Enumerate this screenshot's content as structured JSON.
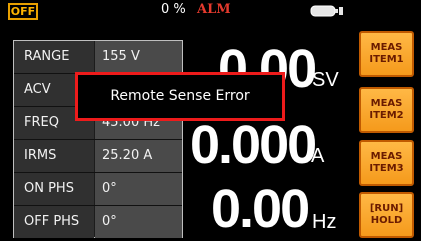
{
  "status": {
    "output_state": "OFF",
    "percent": "0 %",
    "alarm": "ALM",
    "icon": "battery-plug-icon"
  },
  "params": [
    {
      "label": "RANGE",
      "value": "155 V"
    },
    {
      "label": "ACV",
      "value": ""
    },
    {
      "label": "FREQ",
      "value": "45.00 Hz"
    },
    {
      "label": "IRMS",
      "value": "25.20 A"
    },
    {
      "label": "ON PHS",
      "value": "0°"
    },
    {
      "label": "OFF PHS",
      "value": "0°"
    }
  ],
  "readings": {
    "voltage": {
      "value": "0.00",
      "unit": "SV"
    },
    "current": {
      "value": "0.000",
      "unit": "A"
    },
    "frequency": {
      "value": "0.00",
      "unit": "Hz"
    }
  },
  "softkeys": [
    {
      "line1": "MEAS",
      "line2": "ITEM1"
    },
    {
      "line1": "MEAS",
      "line2": "ITEM2"
    },
    {
      "line1": "MEAS",
      "line2": "ITEM3"
    },
    {
      "line1": "[RUN]",
      "line2": "HOLD"
    }
  ],
  "popup": {
    "message": "Remote Sense Error"
  },
  "colors": {
    "off_badge": "#ffb400",
    "alarm": "#e53a2d",
    "softkey": "#f5a623",
    "popup_border": "#ee1b1b"
  }
}
